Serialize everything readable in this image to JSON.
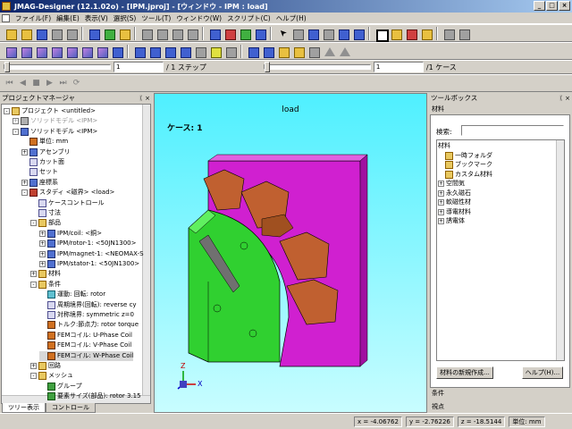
{
  "window": {
    "title": "JMAG-Designer (12.1.02o) - [IPM.jproj] - [ウィンドウ - IPM : load]"
  },
  "menu": [
    "ファイル(F)",
    "編集(E)",
    "表示(V)",
    "選択(S)",
    "ツール(T)",
    "ウィンドウ(W)",
    "スクリプト(C)",
    "ヘルプ(H)"
  ],
  "toolbar3": {
    "step_value": "1",
    "step_label": "/ 1 ステップ",
    "case_value": "1",
    "case_label": "/1 ケース"
  },
  "project_manager": {
    "title": "プロジェクトマネージャ",
    "tree": [
      {
        "label": "プロジェクト <untitled>",
        "icon": "folder",
        "indent": 0,
        "exp": "-"
      },
      {
        "label": "ソリッドモデル <IPM>",
        "icon": "gray",
        "indent": 1,
        "exp": "+",
        "dim": true
      },
      {
        "label": "ソリッドモデル <IPM>",
        "icon": "blue",
        "indent": 1,
        "exp": "-"
      },
      {
        "label": "単位: mm",
        "icon": "orange",
        "indent": 2,
        "exp": ""
      },
      {
        "label": "アセンブリ",
        "icon": "blue",
        "indent": 2,
        "exp": "+"
      },
      {
        "label": "カット面",
        "icon": "grid",
        "indent": 2,
        "exp": ""
      },
      {
        "label": "セット",
        "icon": "grid",
        "indent": 2,
        "exp": ""
      },
      {
        "label": "座標系",
        "icon": "blue",
        "indent": 2,
        "exp": "+"
      },
      {
        "label": "スタディ <磁界> <load>",
        "icon": "red",
        "indent": 2,
        "exp": "-"
      },
      {
        "label": "ケースコントロール",
        "icon": "grid",
        "indent": 3,
        "exp": ""
      },
      {
        "label": "寸法",
        "icon": "grid",
        "indent": 3,
        "exp": ""
      },
      {
        "label": "部品",
        "icon": "folder",
        "indent": 3,
        "exp": "-"
      },
      {
        "label": "IPM/coil: <銅>",
        "icon": "blue",
        "indent": 4,
        "exp": "+"
      },
      {
        "label": "IPM/rotor-1: <50JN1300>",
        "icon": "blue",
        "indent": 4,
        "exp": "+"
      },
      {
        "label": "IPM/magnet-1: <NEOMAX-S",
        "icon": "blue",
        "indent": 4,
        "exp": "+"
      },
      {
        "label": "IPM/stator-1: <50JN1300>",
        "icon": "blue",
        "indent": 4,
        "exp": "+"
      },
      {
        "label": "材料",
        "icon": "folder",
        "indent": 3,
        "exp": "+"
      },
      {
        "label": "条件",
        "icon": "folder",
        "indent": 3,
        "exp": "-"
      },
      {
        "label": "運動: 回転: rotor",
        "icon": "cyan",
        "indent": 4,
        "exp": ""
      },
      {
        "label": "周期境界(回転): reverse cy",
        "icon": "grid",
        "indent": 4,
        "exp": ""
      },
      {
        "label": "対称境界: symmetric z=0",
        "icon": "grid",
        "indent": 4,
        "exp": ""
      },
      {
        "label": "トルク:節点力: rotor torque",
        "icon": "orange",
        "indent": 4,
        "exp": ""
      },
      {
        "label": "FEMコイル: U-Phase Coil",
        "icon": "orange",
        "indent": 4,
        "exp": ""
      },
      {
        "label": "FEMコイル: V-Phase Coil",
        "icon": "orange",
        "indent": 4,
        "exp": ""
      },
      {
        "label": "FEMコイル: W-Phase Coil",
        "icon": "orange",
        "indent": 4,
        "exp": "",
        "selected": true
      },
      {
        "label": "回路",
        "icon": "folder",
        "indent": 3,
        "exp": "+"
      },
      {
        "label": "メッシュ",
        "icon": "folder",
        "indent": 3,
        "exp": "-"
      },
      {
        "label": "グループ",
        "icon": "green",
        "indent": 4,
        "exp": ""
      },
      {
        "label": "要素サイズ(部品): rotor 3.15",
        "icon": "green",
        "indent": 4,
        "exp": ""
      }
    ],
    "tabs": [
      "ツリー表示",
      "コントロール"
    ]
  },
  "viewport": {
    "title": "load",
    "case_label": "ケース: 1",
    "axis_z": "Z",
    "axis_x": "X"
  },
  "toolbox": {
    "title": "ツールボックス",
    "section": "材料",
    "search_label": "検索:",
    "tree": [
      {
        "label": "材料",
        "indent": 0,
        "exp": "",
        "icon": "none"
      },
      {
        "label": "一時フォルダ",
        "indent": 1,
        "exp": "",
        "icon": "folder"
      },
      {
        "label": "ブックマーク",
        "indent": 1,
        "exp": "",
        "icon": "folder"
      },
      {
        "label": "カスタム材料",
        "indent": 1,
        "exp": "",
        "icon": "folder"
      },
      {
        "label": "空間気",
        "indent": 0,
        "exp": "+",
        "icon": "none"
      },
      {
        "label": "永久磁石",
        "indent": 0,
        "exp": "+",
        "icon": "none"
      },
      {
        "label": "軟磁性材",
        "indent": 0,
        "exp": "+",
        "icon": "none"
      },
      {
        "label": "導電材料",
        "indent": 0,
        "exp": "+",
        "icon": "none"
      },
      {
        "label": "誘電体",
        "indent": 0,
        "exp": "+",
        "icon": "none"
      }
    ],
    "new_button": "材料の新規作成...",
    "help_button": "ヘルプ(H)...",
    "cond_section": "条件",
    "view_section": "視点"
  },
  "status": {
    "x": "x = -4.06762",
    "y": "y = -2.76226",
    "z": "z = -18.5144",
    "unit": "単位: mm"
  }
}
